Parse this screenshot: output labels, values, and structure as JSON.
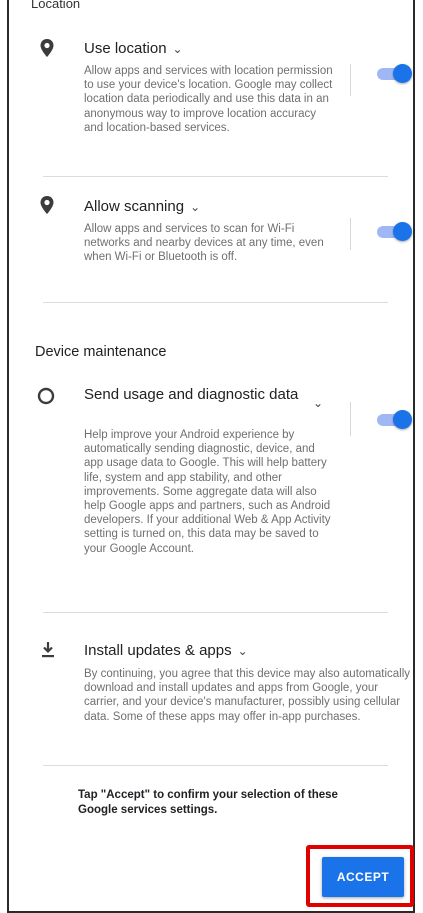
{
  "location_section": {
    "heading_fragment": "Location"
  },
  "items": [
    {
      "title": "Use location",
      "description": "Allow apps and services with location permission to use your device's location. Google may collect location data periodically and use this data in an anonymous way to improve location accuracy and location-based services.",
      "toggle_on": true,
      "icon": "location-pin-icon"
    },
    {
      "title": "Allow scanning",
      "description": "Allow apps and services to scan for Wi-Fi networks and nearby devices at any time, even when Wi-Fi or Bluetooth is off.",
      "toggle_on": true,
      "icon": "location-pin-icon"
    },
    {
      "title": "Send usage and diagnostic data",
      "description": "Help improve your Android experience by automatically sending diagnostic, device, and app usage data to Google. This will help battery life, system and app stability, and other improvements. Some aggregate data will also help Google apps and partners, such as Android developers. If your additional Web & App Activity setting is turned on, this data may be saved to your Google Account.",
      "toggle_on": true,
      "icon": "circle-icon"
    },
    {
      "title": "Install updates & apps",
      "description": "By continuing, you agree that this device may also automatically download and install updates and apps from Google, your carrier, and your device's manufacturer, possibly using cellular data. Some of these apps may offer in-app purchases.",
      "icon": "download-icon"
    }
  ],
  "device_maintenance": {
    "heading": "Device maintenance"
  },
  "confirm_text": "Tap \"Accept\" to confirm your selection of these Google services settings.",
  "accept_button": {
    "label": "ACCEPT",
    "color": "#1a73e8",
    "highlight_color": "#e00000"
  }
}
